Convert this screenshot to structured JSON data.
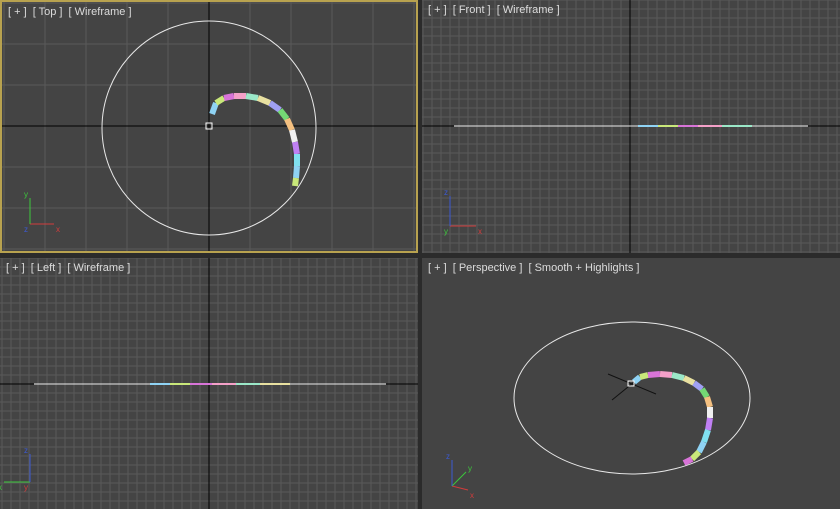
{
  "viewports": {
    "top": {
      "label_parts": [
        "[ + ]",
        "[ Top ]",
        "[ Wireframe ]"
      ],
      "active": true
    },
    "front": {
      "label_parts": [
        "[ + ]",
        "[ Front ]",
        "[ Wireframe ]"
      ],
      "active": false
    },
    "left": {
      "label_parts": [
        "[ + ]",
        "[ Left ]",
        "[ Wireframe ]"
      ],
      "active": false
    },
    "perspective": {
      "label_parts": [
        "[ + ]",
        "[ Perspective ]",
        "[ Smooth + Highlights ]"
      ],
      "active": false
    }
  },
  "axis_labels": {
    "x": "x",
    "y": "y",
    "z": "z"
  },
  "colors": {
    "viewport_bg": "#444444",
    "grid_line": "#5a5a5a",
    "grid_major": "#000000",
    "active_border": "#b8a24f",
    "circle": "#e8e8e8",
    "axis_x": "#d23c3c",
    "axis_y": "#3cc83c",
    "axis_z": "#3c5ad2"
  },
  "spiral_colors": [
    "#8fd3f4",
    "#c9e87a",
    "#d874d8",
    "#f4a0c8",
    "#9be8c8",
    "#e8e0a0",
    "#a0a0f4",
    "#74d874",
    "#f4c080",
    "#f0f0f0",
    "#c080f4",
    "#80e0f0"
  ]
}
